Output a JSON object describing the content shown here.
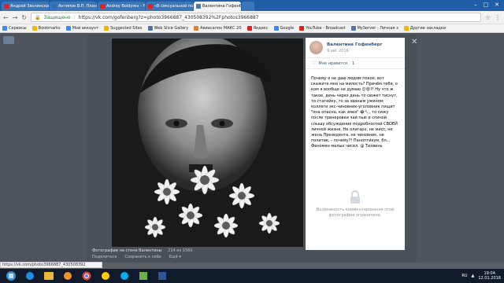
{
  "tabs": [
    {
      "label": "Андрей Зволинский: Истор",
      "icon": "youtube-icon",
      "color": "#e62117",
      "active": false
    },
    {
      "label": "Антипов В.П. Планиро",
      "icon": "doc-icon",
      "color": "#2f6fb6",
      "active": false
    },
    {
      "label": "Andrey Boldyrev - YouTube",
      "icon": "youtube-icon",
      "color": "#e62117",
      "active": false
    },
    {
      "label": "«В сексуальной позе ...",
      "icon": "youtube-icon",
      "color": "#e62117",
      "active": false
    },
    {
      "label": "Валентина Гофенберг",
      "icon": "vk-icon",
      "color": "#4a76a8",
      "active": true
    },
    {
      "label": "",
      "icon": "new-tab-icon",
      "color": "#3c75b8",
      "active": false
    }
  ],
  "address": {
    "secure_label": "Защищено",
    "url": "https://vk.com/gofenberg?z=photo3966887_430508392%2Fphotos3966887"
  },
  "bookmarks": [
    {
      "label": "Сервисы",
      "color": "#4285f4"
    },
    {
      "label": "Bookmarks",
      "color": "#f4b400"
    },
    {
      "label": "Мой аккаунт",
      "color": "#4285f4"
    },
    {
      "label": "Suggested Sites",
      "color": "#f4b400"
    },
    {
      "label": "Web Slice Gallery",
      "color": "#4a76a8"
    },
    {
      "label": "Авиасалон МАКС 20",
      "color": "#e0842e"
    },
    {
      "label": "Яндекс",
      "color": "#e62117"
    },
    {
      "label": "Google",
      "color": "#4285f4"
    },
    {
      "label": "YouTube - Broadcast",
      "color": "#e62117"
    },
    {
      "label": "MyServer - Личная з",
      "color": "#4a76a8"
    },
    {
      "label": "Другие закладки",
      "color": "#f4b400"
    }
  ],
  "post": {
    "author": "Валентина Гофенберг",
    "date": "9 авг 2016",
    "likes_label": "Мне нравится",
    "likes_count": "1",
    "text": "Почему я не даю людям покоя, вот скажите мне на милость? Причём тебя, о ком я вообще не думаю 😕😵?! Ну что ж такое, день через день то сюжет тиснут, то статейку, то за званым ужином коллеги экс-чиновник-уголовник пищит \"она опасна, как змея\" 😂🔧, то сижу после тренеровки чай пью и спиной слышу обсуждение подробностей СВОЕЙ личной жизни. Не олигарх, не мисс, не жена Президента, не чиновник, не политик, - почему?! Паноптикум, бл... Феномен малых чисел. @ Тихвинь",
    "comments_closed": "Возможность комментирования этой фотографии ограничена."
  },
  "caption": {
    "title": "Фотографии на стене Валентины",
    "counter": "214 из 1560",
    "share": "Поделиться",
    "save": "Сохранить к себе",
    "more": "Ещё"
  },
  "status_url": "https://vk.com/photo3966887_430508392",
  "tray": {
    "lang": "RU",
    "time": "19:04",
    "date": "12.01.2018"
  }
}
